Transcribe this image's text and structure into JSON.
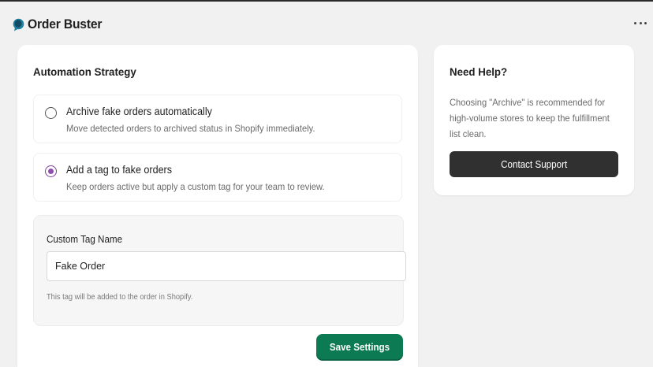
{
  "app": {
    "name": "Order Buster",
    "logo_icon": "chat-bubble-icon",
    "menu_icon": "more-horizontal-icon"
  },
  "strategy": {
    "title": "Automation Strategy",
    "options": [
      {
        "title": "Archive fake orders automatically",
        "description": "Move detected orders to archived status in Shopify immediately.",
        "selected": false
      },
      {
        "title": "Add a tag to fake orders",
        "description": "Keep orders active but apply a custom tag for your team to review.",
        "selected": true
      }
    ],
    "tag": {
      "label": "Custom Tag Name",
      "value": "Fake Order",
      "help": "This tag will be added to the order in Shopify."
    },
    "save_label": "Save Settings"
  },
  "help": {
    "title": "Need Help?",
    "lines": [
      "Choosing \"Archive\" is recommended for",
      "high-volume stores to keep the fulfillment",
      "list clean."
    ],
    "contact_label": "Contact Support"
  },
  "colors": {
    "primary": "#0c7a53",
    "radio_selected": "#8e4fb0",
    "dark_button": "#303030",
    "logo": "#1e7fa0"
  }
}
